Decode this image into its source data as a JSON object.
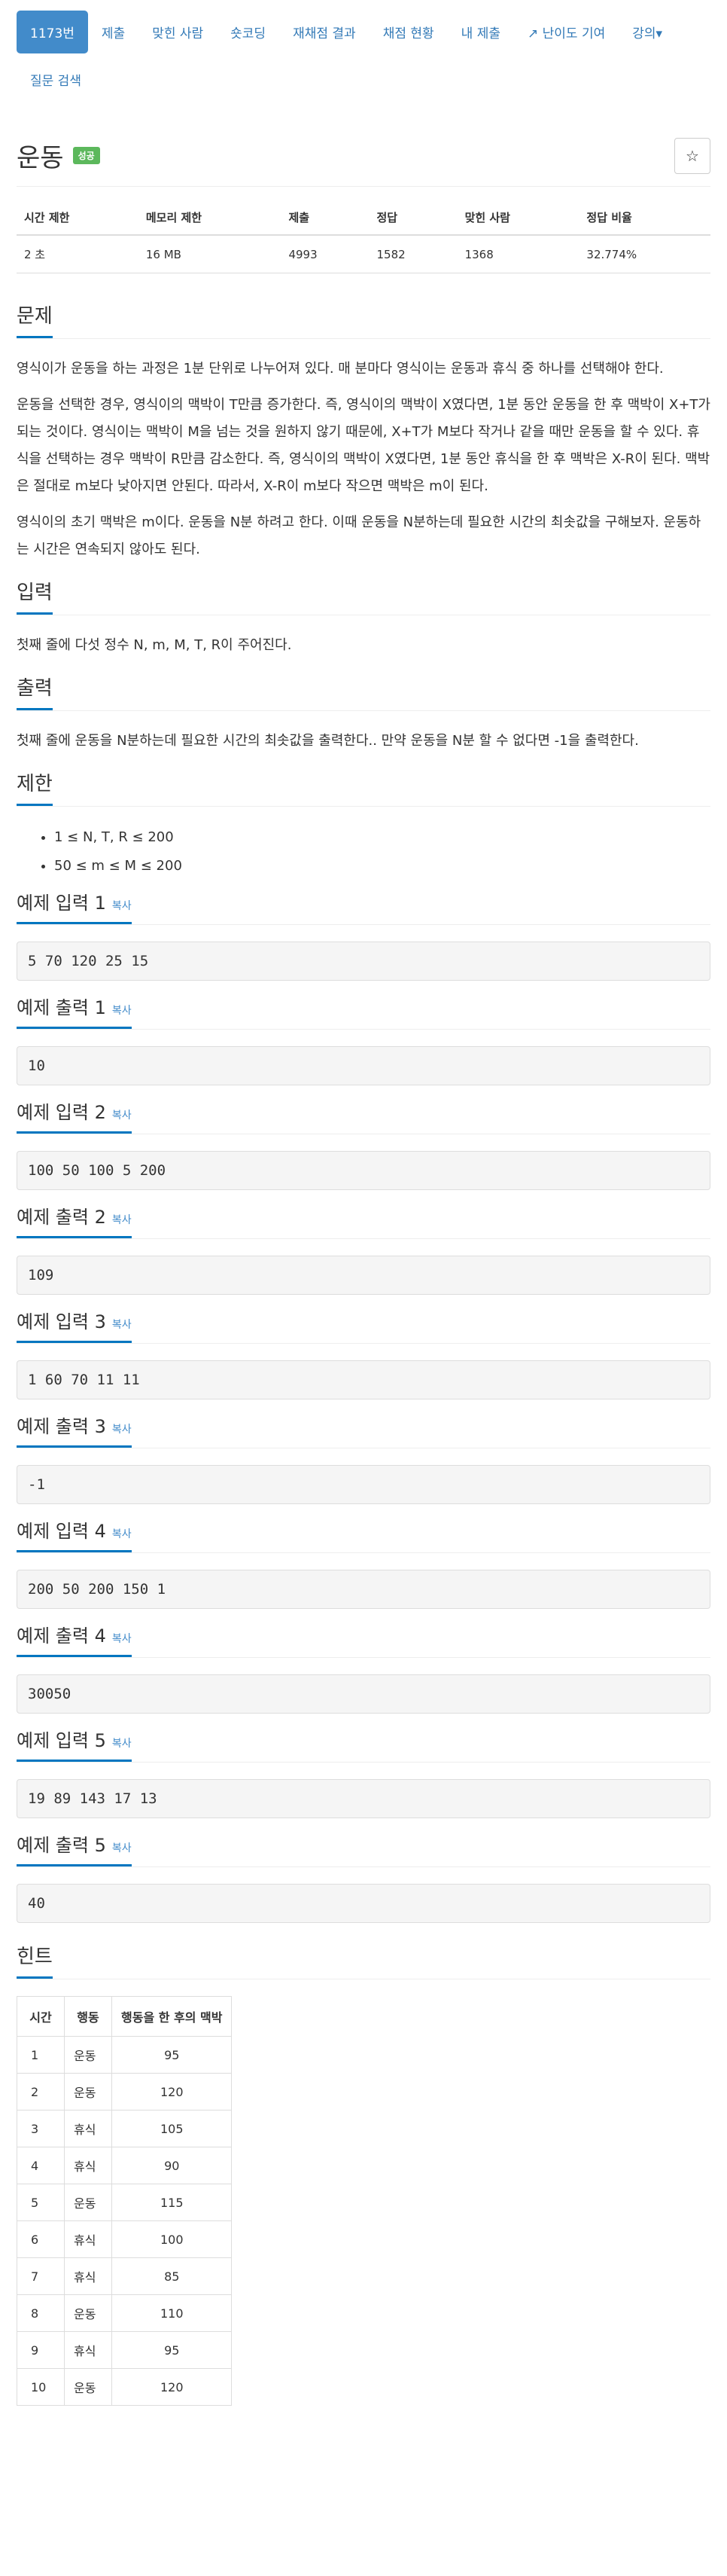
{
  "nav": {
    "items": [
      "1173번",
      "제출",
      "맞힌 사람",
      "숏코딩",
      "재채점 결과",
      "채점 현황",
      "내 제출"
    ],
    "difficulty_label": "난이도 기여",
    "lecture_label": "강의",
    "search_label": "질문 검색"
  },
  "problem": {
    "title": "운동",
    "badge": "성공"
  },
  "stats": {
    "headers": [
      "시간 제한",
      "메모리 제한",
      "제출",
      "정답",
      "맞힌 사람",
      "정답 비율"
    ],
    "values": [
      "2 초",
      "16 MB",
      "4993",
      "1582",
      "1368",
      "32.774%"
    ]
  },
  "sections": {
    "problem_title": "문제",
    "problem_paragraphs": [
      "영식이가 운동을 하는 과정은 1분 단위로 나누어져 있다. 매 분마다 영식이는 운동과 휴식 중 하나를 선택해야 한다.",
      "운동을 선택한 경우, 영식이의 맥박이 T만큼 증가한다. 즉, 영식이의 맥박이 X였다면, 1분 동안 운동을 한 후 맥박이 X+T가 되는 것이다. 영식이는 맥박이 M을 넘는 것을 원하지 않기 때문에, X+T가 M보다 작거나 같을 때만 운동을 할 수 있다. 휴식을 선택하는 경우 맥박이 R만큼 감소한다. 즉, 영식이의 맥박이 X였다면, 1분 동안 휴식을 한 후 맥박은 X-R이 된다. 맥박은 절대로 m보다 낮아지면 안된다. 따라서, X-R이 m보다 작으면 맥박은 m이 된다.",
      "영식이의 초기 맥박은 m이다. 운동을 N분 하려고 한다. 이때 운동을 N분하는데 필요한 시간의 최솟값을 구해보자. 운동하는 시간은 연속되지 않아도 된다."
    ],
    "input_title": "입력",
    "input_text": "첫째 줄에 다섯 정수 N, m, M, T, R이 주어진다.",
    "output_title": "출력",
    "output_text": "첫째 줄에 운동을 N분하는데 필요한 시간의 최솟값을 출력한다.. 만약 운동을 N분 할 수 없다면 -1을 출력한다.",
    "limit_title": "제한",
    "limits": [
      "1 ≤ N, T, R ≤ 200",
      "50 ≤ m ≤ M ≤ 200"
    ],
    "copy_label": "복사",
    "hint_title": "힌트"
  },
  "samples": [
    {
      "in_title": "예제 입력 1",
      "in": "5 70 120 25 15",
      "out_title": "예제 출력 1",
      "out": "10"
    },
    {
      "in_title": "예제 입력 2",
      "in": "100 50 100 5 200",
      "out_title": "예제 출력 2",
      "out": "109"
    },
    {
      "in_title": "예제 입력 3",
      "in": "1 60 70 11 11",
      "out_title": "예제 출력 3",
      "out": "-1"
    },
    {
      "in_title": "예제 입력 4",
      "in": "200 50 200 150 1",
      "out_title": "예제 출력 4",
      "out": "30050"
    },
    {
      "in_title": "예제 입력 5",
      "in": "19 89 143 17 13",
      "out_title": "예제 출력 5",
      "out": "40"
    }
  ],
  "hint_table": {
    "headers": [
      "시간",
      "행동",
      "행동을 한 후의 맥박"
    ],
    "rows": [
      [
        "1",
        "운동",
        "95"
      ],
      [
        "2",
        "운동",
        "120"
      ],
      [
        "3",
        "휴식",
        "105"
      ],
      [
        "4",
        "휴식",
        "90"
      ],
      [
        "5",
        "운동",
        "115"
      ],
      [
        "6",
        "휴식",
        "100"
      ],
      [
        "7",
        "휴식",
        "85"
      ],
      [
        "8",
        "운동",
        "110"
      ],
      [
        "9",
        "휴식",
        "95"
      ],
      [
        "10",
        "운동",
        "120"
      ]
    ]
  }
}
